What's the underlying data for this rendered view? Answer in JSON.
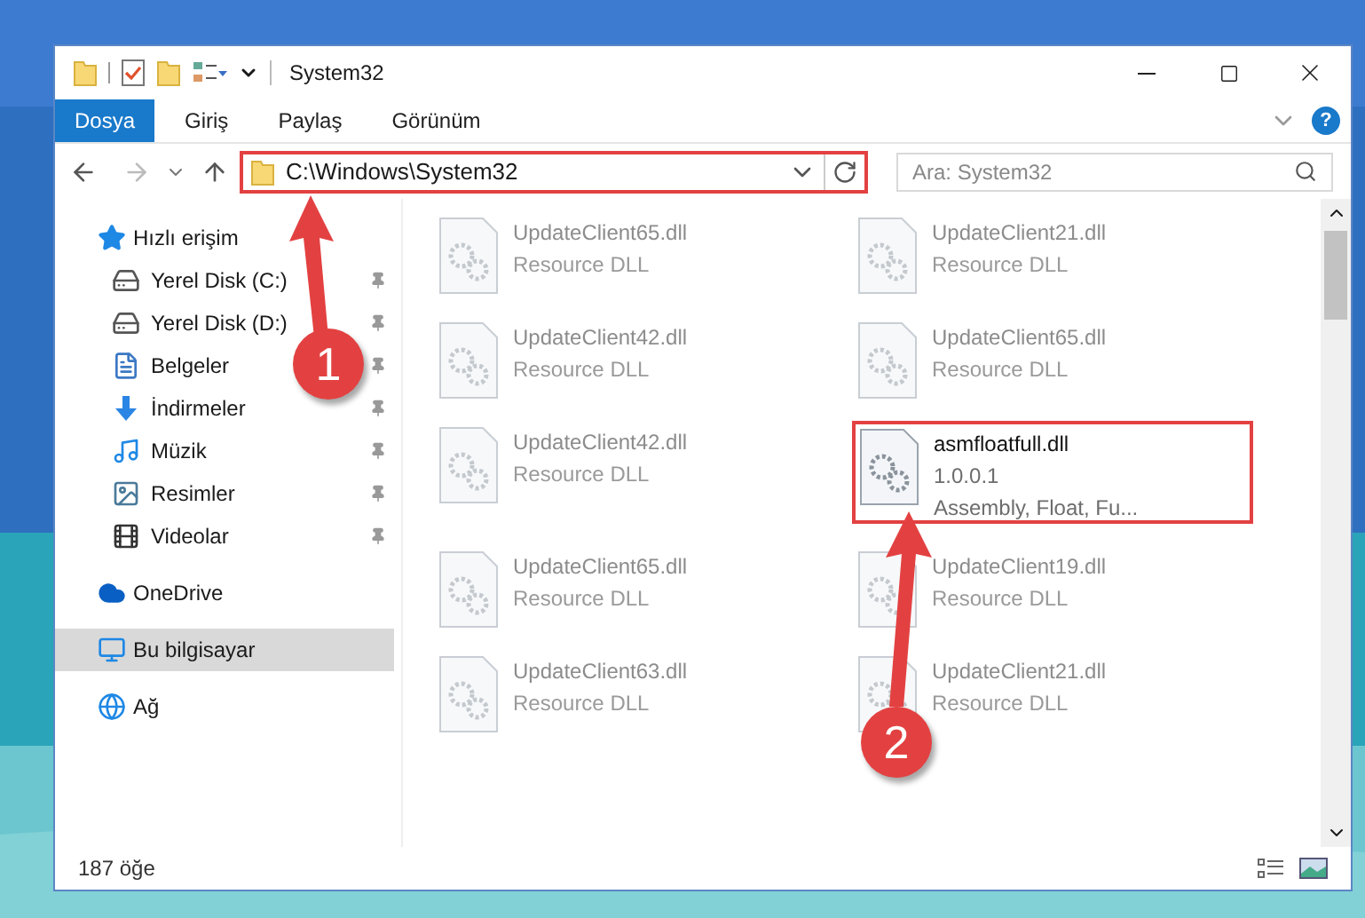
{
  "window": {
    "title": "System32"
  },
  "ribbon": {
    "tabs": [
      {
        "label": "Dosya",
        "selected": true
      },
      {
        "label": "Giriş",
        "selected": false
      },
      {
        "label": "Paylaş",
        "selected": false
      },
      {
        "label": "Görünüm",
        "selected": false
      }
    ],
    "help": "?"
  },
  "address": {
    "path": "C:\\Windows\\System32",
    "highlighted": true
  },
  "search": {
    "placeholder": "Ara: System32"
  },
  "sidebar": {
    "items": [
      {
        "label": "Hızlı erişim",
        "kind": "star",
        "selected": false,
        "children": [
          {
            "label": "Yerel Disk (C:)",
            "kind": "drive-c",
            "pinned": true
          },
          {
            "label": "Yerel Disk (D:)",
            "kind": "drive",
            "pinned": true
          },
          {
            "label": "Belgeler",
            "kind": "docs",
            "pinned": true
          },
          {
            "label": "İndirmeler",
            "kind": "download",
            "pinned": true
          },
          {
            "label": "Müzik",
            "kind": "music",
            "pinned": true
          },
          {
            "label": "Resimler",
            "kind": "pictures",
            "pinned": true
          },
          {
            "label": "Videolar",
            "kind": "videos",
            "pinned": true
          }
        ]
      },
      {
        "label": "OneDrive",
        "kind": "cloud",
        "selected": false
      },
      {
        "label": "Bu bilgisayar",
        "kind": "pc",
        "selected": true
      },
      {
        "label": "Ağ",
        "kind": "network",
        "selected": false
      }
    ]
  },
  "files": [
    {
      "name": "UpdateClient65.dll",
      "lines": [
        "Resource DLL"
      ],
      "blurred": true,
      "highlighted": false
    },
    {
      "name": "UpdateClient21.dll",
      "lines": [
        "Resource DLL"
      ],
      "blurred": true,
      "highlighted": false
    },
    {
      "name": "UpdateClient42.dll",
      "lines": [
        "Resource DLL"
      ],
      "blurred": true,
      "highlighted": false
    },
    {
      "name": "UpdateClient65.dll",
      "lines": [
        "Resource DLL"
      ],
      "blurred": true,
      "highlighted": false
    },
    {
      "name": "UpdateClient42.dll",
      "lines": [
        "Resource DLL"
      ],
      "blurred": true,
      "highlighted": false
    },
    {
      "name": "asmfloatfull.dll",
      "lines": [
        "1.0.0.1",
        "Assembly, Float, Fu..."
      ],
      "blurred": false,
      "highlighted": true
    },
    {
      "name": "UpdateClient65.dll",
      "lines": [
        "Resource DLL"
      ],
      "blurred": true,
      "highlighted": false
    },
    {
      "name": "UpdateClient19.dll",
      "lines": [
        "Resource DLL"
      ],
      "blurred": true,
      "highlighted": false
    },
    {
      "name": "UpdateClient63.dll",
      "lines": [
        "Resource DLL"
      ],
      "blurred": true,
      "highlighted": false
    },
    {
      "name": "UpdateClient21.dll",
      "lines": [
        "Resource DLL"
      ],
      "blurred": true,
      "highlighted": false
    }
  ],
  "status_bar": {
    "count": "187 öğe"
  },
  "annotations": [
    {
      "label": "1"
    },
    {
      "label": "2"
    }
  ]
}
